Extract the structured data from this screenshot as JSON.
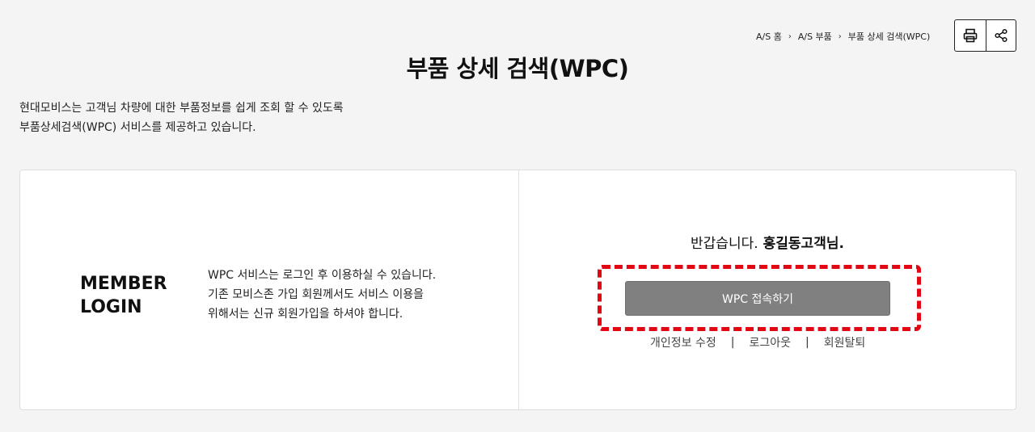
{
  "breadcrumb": {
    "items": [
      "A/S 홈",
      "A/S 부품",
      "부품 상세 검색(WPC)"
    ],
    "separator": "›"
  },
  "actions": {
    "print_icon": "print-icon",
    "share_icon": "share-icon"
  },
  "page": {
    "title": "부품 상세 검색(WPC)",
    "intro_line1": "현대모비스는 고객님 차량에 대한 부품정보를 쉽게 조회 할 수 있도록",
    "intro_line2": "부품상세검색(WPC) 서비스를 제공하고 있습니다."
  },
  "member": {
    "title_line1": "MEMBER",
    "title_line2": "LOGIN",
    "desc_line1": "WPC 서비스는 로그인 후 이용하실 수 있습니다.",
    "desc_line2": "기존 모비스존 가입 회원께서도 서비스 이용을",
    "desc_line3": "위해서는 신규 회원가입을 하셔야 합니다."
  },
  "welcome": {
    "greeting": "반갑습니다.",
    "user_name": "홍길동고객님.",
    "wpc_button_label": "WPC 접속하기",
    "links": [
      "개인정보 수정",
      "로그아웃",
      "회원탈퇴"
    ],
    "link_separator": "|"
  },
  "colors": {
    "highlight": "#e30613",
    "button_bg": "#808080"
  }
}
